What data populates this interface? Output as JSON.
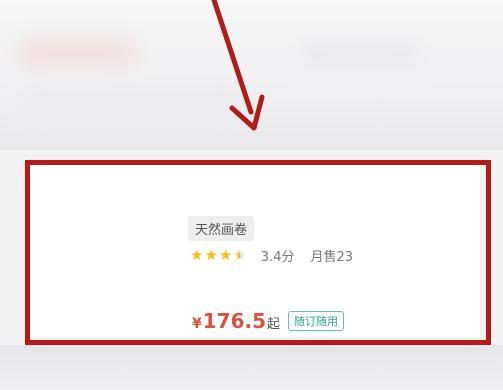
{
  "product": {
    "tag": "天然画卷",
    "stars_value": 3.5,
    "stars_max": 5,
    "score": "3.4分",
    "monthly_sales": "月售23",
    "currency_symbol": "¥",
    "price": "176.5",
    "price_suffix": "起",
    "booking_badge": "随订随用"
  },
  "annotation": {
    "arrow_color": "#b31a1a",
    "box_color": "#b31a1a"
  },
  "colors": {
    "price": "#d9533f",
    "star": "#f2c21b",
    "badge": "#2aa78e"
  }
}
